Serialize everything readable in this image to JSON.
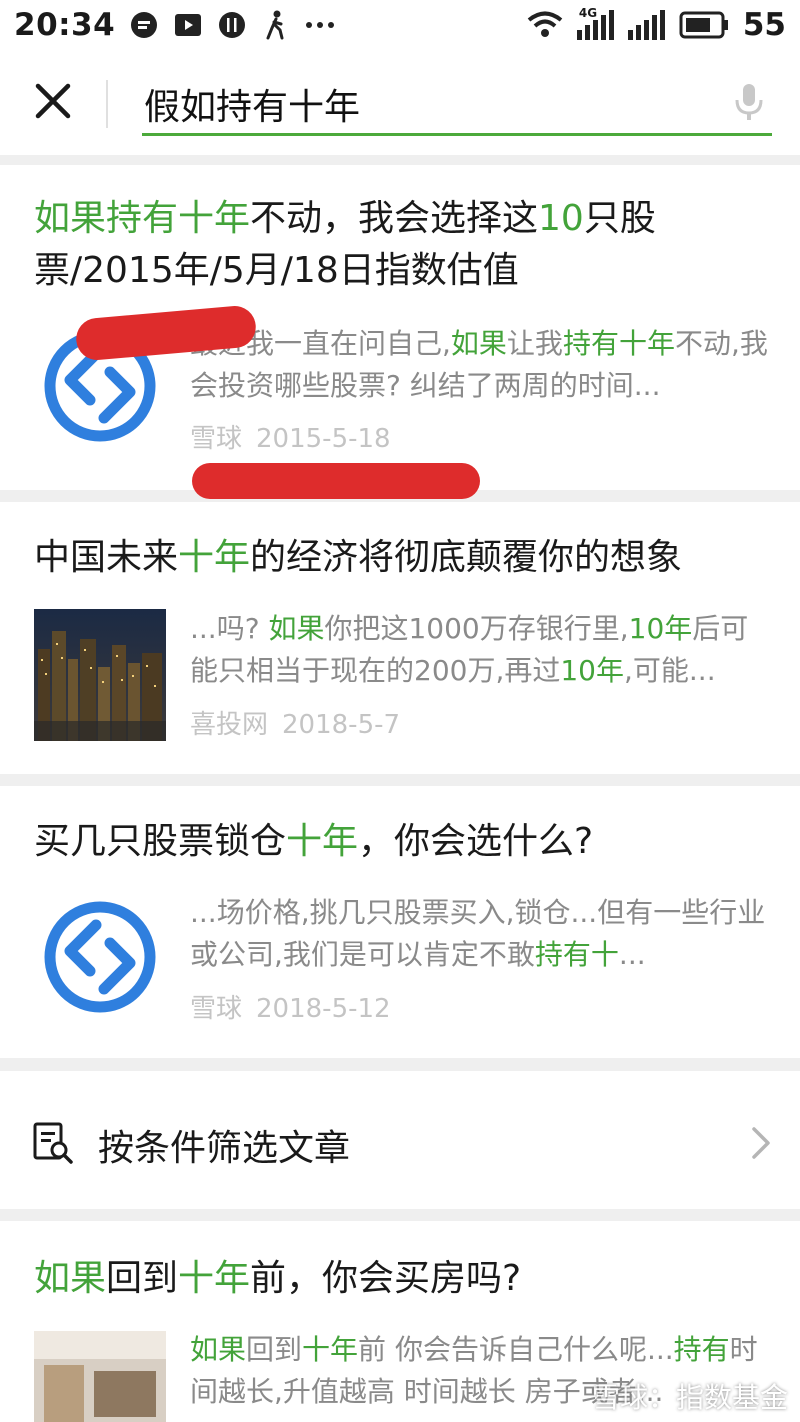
{
  "status_bar": {
    "time": "20:34",
    "network": "4G",
    "battery": "55",
    "left_icons": [
      "message-icon",
      "video-icon",
      "food-icon",
      "walking-icon",
      "more-icon"
    ],
    "right_icons": [
      "wifi-icon",
      "signal-icon",
      "signal-icon",
      "battery-icon"
    ]
  },
  "search": {
    "query": "假如持有十年",
    "accent_color": "#4caa3b"
  },
  "results": [
    {
      "title_parts": [
        {
          "text": "如果持有十年",
          "highlight": true
        },
        {
          "text": "不动，我会选择这",
          "highlight": false
        },
        {
          "text": "10",
          "highlight": true
        },
        {
          "text": "只股票/2015年/5月/18日指数估值",
          "highlight": false
        }
      ],
      "snippet_parts": [
        {
          "text": "最近我一直在问自己,",
          "highlight": false
        },
        {
          "text": "如果",
          "highlight": true
        },
        {
          "text": "让我",
          "highlight": false
        },
        {
          "text": "持有十年",
          "highlight": true
        },
        {
          "text": "不动,我会投资哪些股票? 纠结了两周的时间...",
          "highlight": false
        }
      ],
      "source": "雪球",
      "date": "2015-5-18",
      "thumbnail": "xueqiu-logo"
    },
    {
      "title_parts": [
        {
          "text": "中国未来",
          "highlight": false
        },
        {
          "text": "十年",
          "highlight": true
        },
        {
          "text": "的经济将彻底颠覆你的想象",
          "highlight": false
        }
      ],
      "snippet_parts": [
        {
          "text": "...吗? ",
          "highlight": false
        },
        {
          "text": "如果",
          "highlight": true
        },
        {
          "text": "你把这1000万存银行里,",
          "highlight": false
        },
        {
          "text": "10年",
          "highlight": true
        },
        {
          "text": "后可能只相当于现在的200万,再过",
          "highlight": false
        },
        {
          "text": "10年",
          "highlight": true
        },
        {
          "text": ",可能...",
          "highlight": false
        }
      ],
      "source": "喜投网",
      "date": "2018-5-7",
      "thumbnail": "city-night-photo"
    },
    {
      "title_parts": [
        {
          "text": "买几只股票锁仓",
          "highlight": false
        },
        {
          "text": "十年",
          "highlight": true
        },
        {
          "text": "，你会选什么?",
          "highlight": false
        }
      ],
      "snippet_parts": [
        {
          "text": "...场价格,挑几只股票买入,锁仓...但有一些行业或公司,我们是可以肯定不敢",
          "highlight": false
        },
        {
          "text": "持有十",
          "highlight": true
        },
        {
          "text": "...",
          "highlight": false
        }
      ],
      "source": "雪球",
      "date": "2018-5-12",
      "thumbnail": "xueqiu-logo"
    },
    {
      "title_parts": [
        {
          "text": "如果",
          "highlight": true
        },
        {
          "text": "回到",
          "highlight": false
        },
        {
          "text": "十年",
          "highlight": true
        },
        {
          "text": "前，你会买房吗?",
          "highlight": false
        }
      ],
      "snippet_parts": [
        {
          "text": "如果",
          "highlight": true
        },
        {
          "text": "回到",
          "highlight": false
        },
        {
          "text": "十年",
          "highlight": true
        },
        {
          "text": "前 你会告诉自己什么呢...",
          "highlight": false
        },
        {
          "text": "持有",
          "highlight": true
        },
        {
          "text": "时间越长,升值越高 时间越长 房子或者...",
          "highlight": false
        }
      ],
      "thumbnail": "interior-photo"
    }
  ],
  "filter": {
    "label": "按条件筛选文章",
    "icon": "filter-document-icon"
  },
  "watermark": "雪球：指数基金"
}
